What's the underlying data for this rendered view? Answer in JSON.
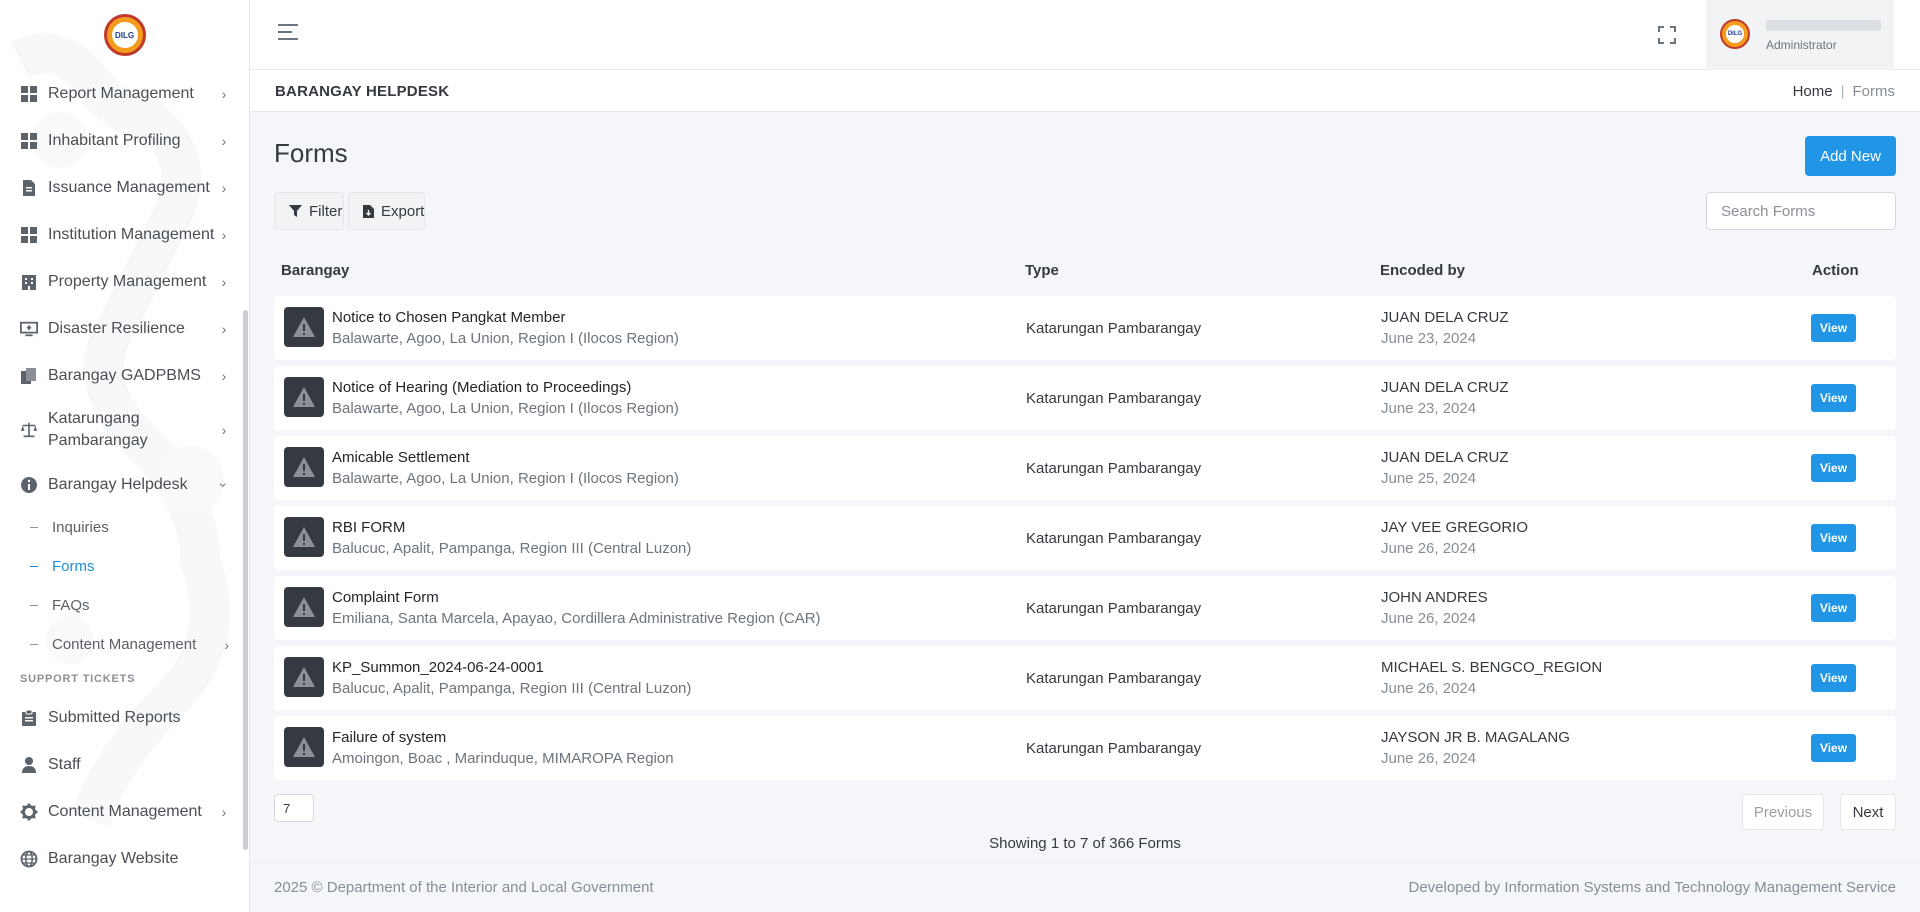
{
  "brand": {
    "logo_text": "DILG"
  },
  "sidebar": {
    "items": [
      {
        "label": "Report Management",
        "icon": "grid-icon"
      },
      {
        "label": "Inhabitant Profiling",
        "icon": "grid-icon"
      },
      {
        "label": "Issuance Management",
        "icon": "document-icon"
      },
      {
        "label": "Institution Management",
        "icon": "grid-icon"
      },
      {
        "label": "Property Management",
        "icon": "building-icon"
      },
      {
        "label": "Disaster Resilience",
        "icon": "monitor-plus-icon"
      },
      {
        "label": "Barangay GADPBMS",
        "icon": "documents-icon"
      },
      {
        "label": "Katarungang Pambarangay",
        "icon": "scale-icon"
      },
      {
        "label": "Barangay Helpdesk",
        "icon": "info-icon"
      }
    ],
    "sub_items": [
      {
        "label": "Inquiries"
      },
      {
        "label": "Forms"
      },
      {
        "label": "FAQs"
      },
      {
        "label": "Content Management"
      }
    ],
    "section_label": "SUPPORT TICKETS",
    "support_items": [
      {
        "label": "Submitted Reports",
        "icon": "clipboard-icon"
      },
      {
        "label": "Staff",
        "icon": "user-icon"
      },
      {
        "label": "Content Management",
        "icon": "gear-icon"
      },
      {
        "label": "Barangay Website",
        "icon": "globe-icon"
      }
    ]
  },
  "topbar": {
    "user_role": "Administrator"
  },
  "breadcrumb": {
    "title": "BARANGAY HELPDESK",
    "home": "Home",
    "current": "Forms"
  },
  "main": {
    "title": "Forms",
    "add_label": "Add New",
    "filter_label": "Filter",
    "export_label": "Export",
    "search_placeholder": "Search Forms"
  },
  "table": {
    "headers": {
      "barangay": "Barangay",
      "type": "Type",
      "encoded_by": "Encoded by",
      "action": "Action"
    },
    "rows": [
      {
        "name": "Notice to Chosen Pangkat Member",
        "location": "Balawarte, Agoo, La Union, Region I (Ilocos Region)",
        "type": "Katarungan Pambarangay",
        "encoder": "JUAN DELA CRUZ",
        "date": "June 23, 2024",
        "action": "View"
      },
      {
        "name": "Notice of Hearing (Mediation to Proceedings)",
        "location": "Balawarte, Agoo, La Union, Region I (Ilocos Region)",
        "type": "Katarungan Pambarangay",
        "encoder": "JUAN DELA CRUZ",
        "date": "June 23, 2024",
        "action": "View"
      },
      {
        "name": "Amicable Settlement",
        "location": "Balawarte, Agoo, La Union, Region I (Ilocos Region)",
        "type": "Katarungan Pambarangay",
        "encoder": "JUAN DELA CRUZ",
        "date": "June 25, 2024",
        "action": "View"
      },
      {
        "name": "RBI FORM",
        "location": "Balucuc, Apalit, Pampanga, Region III (Central Luzon)",
        "type": "Katarungan Pambarangay",
        "encoder": "JAY VEE GREGORIO",
        "date": "June 26, 2024",
        "action": "View"
      },
      {
        "name": "Complaint Form",
        "location": "Emiliana, Santa Marcela, Apayao, Cordillera Administrative Region (CAR)",
        "type": "Katarungan Pambarangay",
        "encoder": "JOHN ANDRES",
        "date": "June 26, 2024",
        "action": "View"
      },
      {
        "name": "KP_Summon_2024-06-24-0001",
        "location": "Balucuc, Apalit, Pampanga, Region III (Central Luzon)",
        "type": "Katarungan Pambarangay",
        "encoder": "MICHAEL S. BENGCO_REGION",
        "date": "June 26, 2024",
        "action": "View"
      },
      {
        "name": "Failure of system",
        "location": "Amoingon, Boac , Marinduque, MIMAROPA Region",
        "type": "Katarungan Pambarangay",
        "encoder": "JAYSON JR B. MAGALANG",
        "date": "June 26, 2024",
        "action": "View"
      }
    ]
  },
  "pagination": {
    "page_size": "7",
    "previous": "Previous",
    "next": "Next",
    "showing": "Showing 1 to 7 of 366 Forms"
  },
  "footer": {
    "left": "2025 © Department of the Interior and Local Government",
    "right": "Developed by Information Systems and Technology Management Service"
  },
  "colors": {
    "accent": "#2196e6",
    "active_link": "#1f8fd6"
  }
}
